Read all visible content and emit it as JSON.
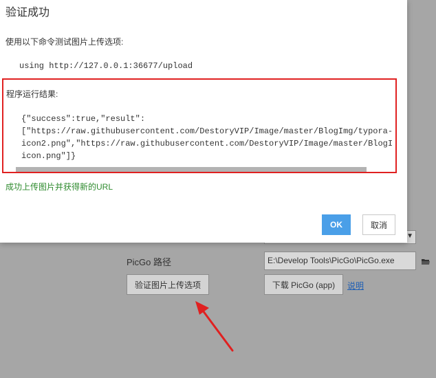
{
  "dialog": {
    "title": "验证成功",
    "description": "使用以下命令测试图片上传选项:",
    "command": "using http://127.0.0.1:36677/upload",
    "result_label": "程序运行结果:",
    "result_lines": [
      "{\"success\":true,\"result\":",
      "[\"https://raw.githubusercontent.com/DestoryVIP/Image/master/BlogImg/typora-",
      "icon2.png\",\"https://raw.githubusercontent.com/DestoryVIP/Image/master/BlogImg/",
      "icon.png\"]}"
    ],
    "success_message": "成功上传图片并获得新的URL",
    "ok_label": "OK",
    "cancel_label": "取消"
  },
  "background": {
    "picgo_path_label": "PicGo 路径",
    "picgo_path_value": "E:\\Develop Tools\\PicGo\\PicGo.exe",
    "verify_button_label": "验证图片上传选项",
    "download_button_label": "下载 PicGo (app)",
    "help_link_label": "说明"
  },
  "colors": {
    "highlight_border": "#e02020",
    "annotation_arrow": "#e02020",
    "ok_button": "#4a9fe8",
    "success_text": "#2e8b2e",
    "link": "#1e5fb5"
  },
  "icons": {
    "folder": "folder-icon",
    "select_arrow": "chevron-down-icon"
  }
}
